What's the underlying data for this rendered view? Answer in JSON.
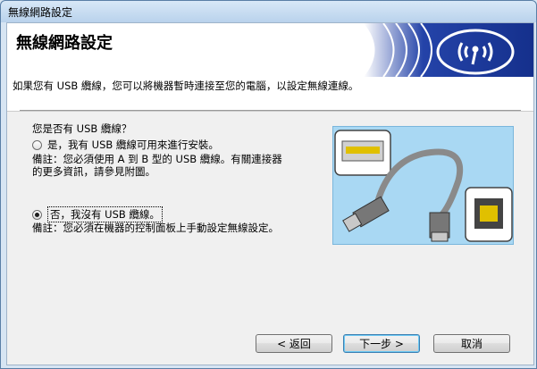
{
  "window": {
    "title": "無線網路設定"
  },
  "banner": {
    "title": "無線網路設定",
    "logo_icon": "wifi-signal-icon"
  },
  "intro": {
    "text": "如果您有 USB 纜線，您可以將機器暫時連接至您的電腦，以設定無線連線。"
  },
  "question": {
    "text": "您是否有 USB 纜線？"
  },
  "options": [
    {
      "label": "是，我有 USB 纜線可用來進行安裝。",
      "checked": false,
      "note_line1": "備註：您必須使用 A 到 B 型的 USB 纜線。有關連接器",
      "note_line2": "的更多資訊，請參見附圖。"
    },
    {
      "label": "否，我沒有 USB 纜線。",
      "checked": true,
      "note_line1": "備註：您必須在機器的控制面板上手動設定無線設定。"
    }
  ],
  "buttons": {
    "back": "< 返回",
    "next": "下一步 >",
    "cancel": "取消"
  },
  "colors": {
    "illustration_bg": "#a9d8f3",
    "banner_blue": "#1a3a9c"
  }
}
